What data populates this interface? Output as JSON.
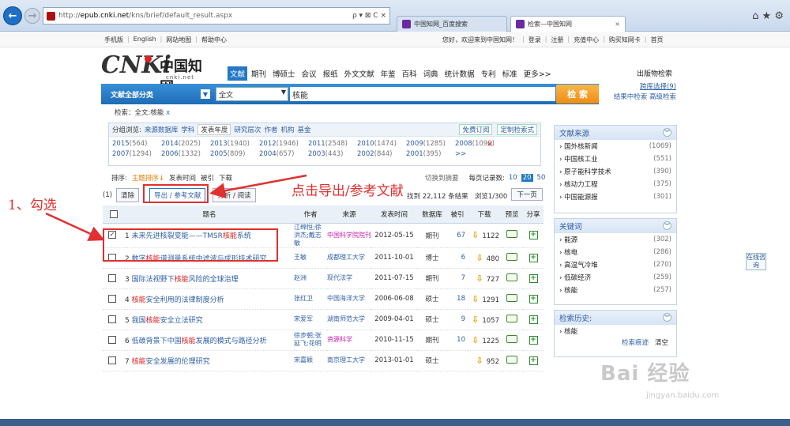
{
  "browser": {
    "url_prefix": "http://",
    "url_domain": "epub.cnki.net",
    "url_path": "/kns/brief/default_result.aspx",
    "addr_controls": "ρ ▾ ⊠ C ×",
    "tabs": [
      {
        "label": "中国知网_百度搜索"
      },
      {
        "label": "检索—中国知网"
      }
    ],
    "tab_close": "×",
    "tool_icons": "⌂ ★ ⚙"
  },
  "topbar": {
    "left": [
      "手机版",
      "English",
      "网站地图",
      "帮助中心"
    ],
    "right": [
      "您好，欢迎来到中国知网！",
      "登录",
      "注册",
      "充值中心",
      "购买知网卡",
      "首页"
    ]
  },
  "logo": {
    "cnki": "CNKi",
    "cn": "中国知网",
    "sub": "cnki.net"
  },
  "nav": {
    "items": [
      "文献",
      "期刊",
      "博硕士",
      "会议",
      "报纸",
      "外文文献",
      "年鉴",
      "百科",
      "词典",
      "统计数据",
      "专利",
      "标准",
      "更多>>"
    ],
    "pub_search": "出版物检索"
  },
  "search": {
    "category": "文献全部分类",
    "field": "全文",
    "keyword": "核能",
    "button": "检 索",
    "dropdown": "▼"
  },
  "right_links": {
    "cross": "跨库选择(9)",
    "in_result": "结果中检索",
    "advanced": "高级检索"
  },
  "breadcrumb": {
    "text": "检索：全文:核能",
    "remove": "x"
  },
  "group": {
    "label": "分组浏览:",
    "items": [
      "来源数据库",
      "学科",
      "发表年度",
      "研究层次",
      "作者",
      "机构",
      "基金"
    ],
    "active": "发表年度",
    "btn_subscribe": "免费订阅",
    "btn_custom": "定制检索式",
    "close": "×",
    "years": [
      {
        "y": "2015",
        "c": "(564)"
      },
      {
        "y": "2014",
        "c": "(2025)"
      },
      {
        "y": "2013",
        "c": "(1940)"
      },
      {
        "y": "2012",
        "c": "(1946)"
      },
      {
        "y": "2011",
        "c": "(2548)"
      },
      {
        "y": "2010",
        "c": "(1474)"
      },
      {
        "y": "2009",
        "c": "(1285)"
      },
      {
        "y": "2008",
        "c": "(1090)"
      },
      {
        "y": "2007",
        "c": "(1294)"
      },
      {
        "y": "2006",
        "c": "(1332)"
      },
      {
        "y": "2005",
        "c": "(809)"
      },
      {
        "y": "2004",
        "c": "(657)"
      },
      {
        "y": "2003",
        "c": "(443)"
      },
      {
        "y": "2002",
        "c": "(844)"
      },
      {
        "y": "2001",
        "c": "(395)"
      },
      {
        "y": ">>",
        "c": ""
      }
    ]
  },
  "sort": {
    "label": "排序:",
    "items": [
      "主题排序",
      "发表时间",
      "被引",
      "下载"
    ],
    "active_arrow": "↓",
    "toggle": "切换到摘要",
    "per_page": "每页记录数:",
    "sizes": [
      "10",
      "20",
      "50"
    ],
    "current_size": "20"
  },
  "ops": {
    "count": "(1)",
    "clear": "清除",
    "export": "导出 / 参考文献",
    "analyze": "分析 / 阅读",
    "found_pre": "找到",
    "found_num": "22,112",
    "found_post": "条结果",
    "browse": "浏览1/300",
    "next": "下一页"
  },
  "table": {
    "headers": [
      "题名",
      "作者",
      "来源",
      "发表时间",
      "数据库",
      "被引",
      "下载",
      "预览",
      "分享"
    ],
    "select_all_checked": false,
    "rows": [
      {
        "n": "1",
        "checked": true,
        "t1": "未来先进核裂变能——TMSR",
        "hl": "核能",
        "t2": "系统",
        "author": "江绵恒;徐洪杰;戴志敏",
        "source": "中国科学院院刊",
        "pink": true,
        "date": "2012-05-15",
        "db": "期刊",
        "cite": "67",
        "dl": "1122"
      },
      {
        "n": "2",
        "checked": false,
        "t1": "数字",
        "hl": "核能",
        "t2": "谱测量系统中滤波与成形技术研究",
        "author": "王敏",
        "source": "成都理工大学",
        "pink": false,
        "date": "2011-10-01",
        "db": "博士",
        "cite": "6",
        "dl": "480"
      },
      {
        "n": "3",
        "checked": false,
        "t1": "国际法视野下",
        "hl": "核能",
        "t2": "风险的全球治理",
        "author": "赵洲",
        "source": "现代法学",
        "pink": false,
        "date": "2011-07-15",
        "db": "期刊",
        "cite": "7",
        "dl": "727"
      },
      {
        "n": "4",
        "checked": false,
        "t1": "",
        "hl": "核能",
        "t2": "安全利用的法律制度分析",
        "author": "张红卫",
        "source": "中国海洋大学",
        "pink": false,
        "date": "2006-06-08",
        "db": "硕士",
        "cite": "18",
        "dl": "1291"
      },
      {
        "n": "5",
        "checked": false,
        "t1": "我国",
        "hl": "核能",
        "t2": "安全立法研究",
        "author": "宋爱军",
        "source": "湖南师范大学",
        "pink": false,
        "date": "2009-04-01",
        "db": "硕士",
        "cite": "9",
        "dl": "1057"
      },
      {
        "n": "6",
        "checked": false,
        "t1": "低碳背景下中国",
        "hl": "核能",
        "t2": "发展的模式与路径分析",
        "author": "徐步朝;张延飞;花明",
        "source": "资源科学",
        "pink": true,
        "date": "2010-11-15",
        "db": "期刊",
        "cite": "10",
        "dl": "1225"
      },
      {
        "n": "7",
        "checked": false,
        "t1": "",
        "hl": "核能",
        "t2": "安全发展的伦理研究",
        "author": "宋嘉颖",
        "source": "南京理工大学",
        "pink": false,
        "date": "2013-01-01",
        "db": "硕士",
        "cite": "",
        "dl": "952"
      }
    ]
  },
  "sidebar": {
    "source": {
      "title": "文献来源",
      "items": [
        {
          "label": "国外核新闻",
          "count": "(1069)"
        },
        {
          "label": "中国核工业",
          "count": "(551)"
        },
        {
          "label": "原子能科学技术",
          "count": "(390)"
        },
        {
          "label": "核动力工程",
          "count": "(375)"
        },
        {
          "label": "中国能源报",
          "count": "(301)"
        }
      ]
    },
    "keywords": {
      "title": "关键词",
      "items": [
        {
          "label": "能源",
          "count": "(302)"
        },
        {
          "label": "核电",
          "count": "(286)"
        },
        {
          "label": "高温气冷堆",
          "count": "(270)"
        },
        {
          "label": "低碳经济",
          "count": "(259)"
        },
        {
          "label": "核能",
          "count": "(257)"
        }
      ]
    },
    "history": {
      "title": "检索历史:",
      "item": "核能",
      "trace": "检索痕迹",
      "clear": "清空"
    },
    "collapse": "︾"
  },
  "online": "在线咨询",
  "annotations": {
    "step1": "1、勾选",
    "step2": "点击导出/参考文献"
  },
  "watermark": {
    "main": "Bai 经验",
    "sub": "jingyan.baidu.com"
  },
  "colors": {
    "accent": "#2478c5",
    "highlight": "#d22222",
    "annotation": "#e03030",
    "search_btn": "#ee8d12"
  }
}
